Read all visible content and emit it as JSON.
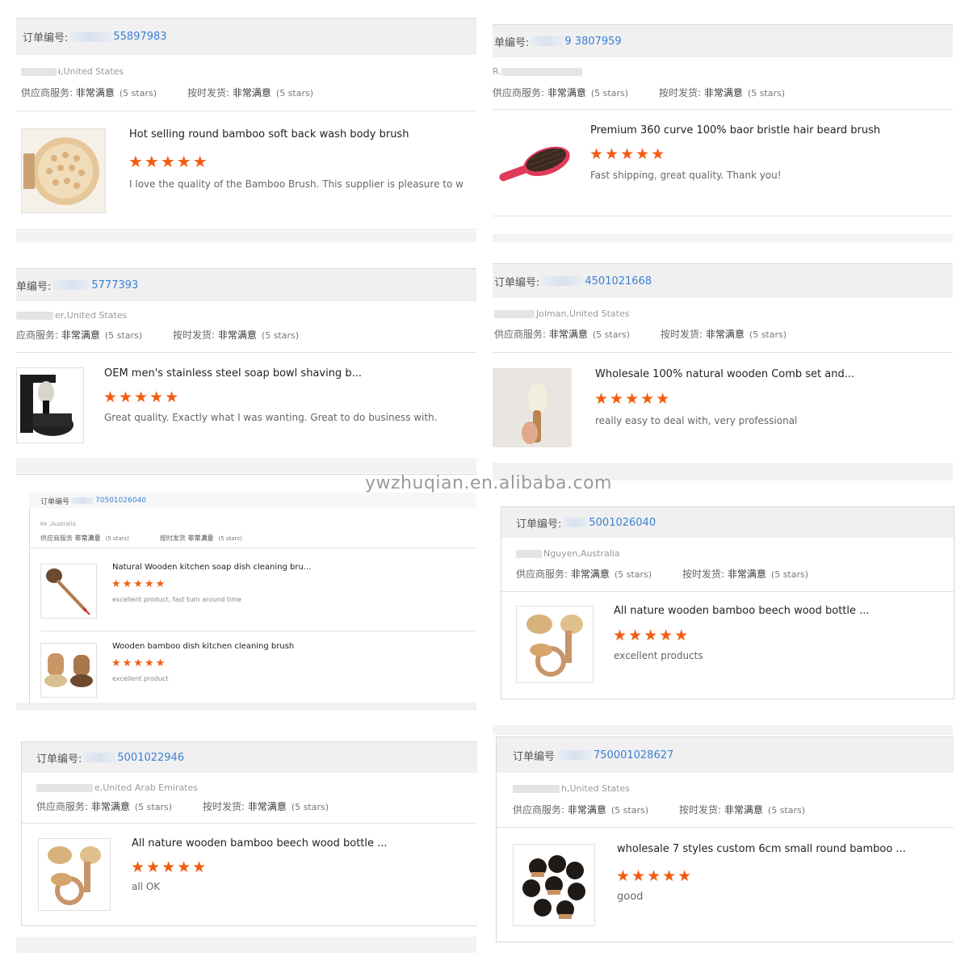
{
  "watermark": "ywzhuqian.en.alibaba.com",
  "labels": {
    "order_prefix": "订单编号:",
    "order_prefix_cut": "单编号:",
    "order_prefix_cut2": "订单编号",
    "supplier_service": "供应商服务:",
    "supplier_service_cut": "应商服务:",
    "supplier_service_cut2": "供应商服务",
    "on_time": "按时发货:",
    "on_time_cut": "按时发货",
    "very_satisfied": "非常满意",
    "five_stars": "(5 stars)",
    "stars_glyph": "★★★★★"
  },
  "reviews": [
    {
      "order_number": "55897983",
      "location": "ɨ,United States",
      "products": [
        {
          "title": "Hot selling round bamboo soft back wash body brush",
          "review": "I love the quality of the Bamboo Brush. This supplier is pleasure to w"
        }
      ]
    },
    {
      "order_number": "9  3807959",
      "location": "R.",
      "products": [
        {
          "title": "Premium 360 curve 100% baor bristle hair beard brush",
          "review": "Fast shipping,  great quality. Thank you!"
        }
      ]
    },
    {
      "order_number": "5777393",
      "location": "er,United States",
      "products": [
        {
          "title": "OEM men's stainless steel soap bowl shaving b...",
          "review": "Great quality.  Exactly what I was wanting.  Great to do business with."
        }
      ]
    },
    {
      "order_number": "4501021668",
      "location": "Jolman,United States",
      "products": [
        {
          "title": "Wholesale 100% natural wooden Comb set and...",
          "review": "really easy to deal with, very professional"
        }
      ]
    },
    {
      "order_number": "70501026040",
      "location": "Ke ,Australia",
      "products": [
        {
          "title": "Natural Wooden kitchen soap dish cleaning bru...",
          "review": "excellent product, fast turn around time"
        },
        {
          "title": "Wooden bamboo dish kitchen cleaning brush",
          "review": "excellent product"
        }
      ]
    },
    {
      "order_number": "5001026040",
      "location": "Nguyen,Australia",
      "products": [
        {
          "title": "All nature wooden bamboo beech wood bottle ...",
          "review": "excellent products"
        }
      ]
    },
    {
      "order_number": "5001022946",
      "location": "e,United Arab Emirates",
      "products": [
        {
          "title": "All nature wooden bamboo beech wood bottle ...",
          "review": "all OK"
        }
      ]
    },
    {
      "order_number": "750001028627",
      "location": "h,United States",
      "products": [
        {
          "title": "wholesale 7 styles custom 6cm small round bamboo ...",
          "review": "good"
        }
      ]
    }
  ]
}
